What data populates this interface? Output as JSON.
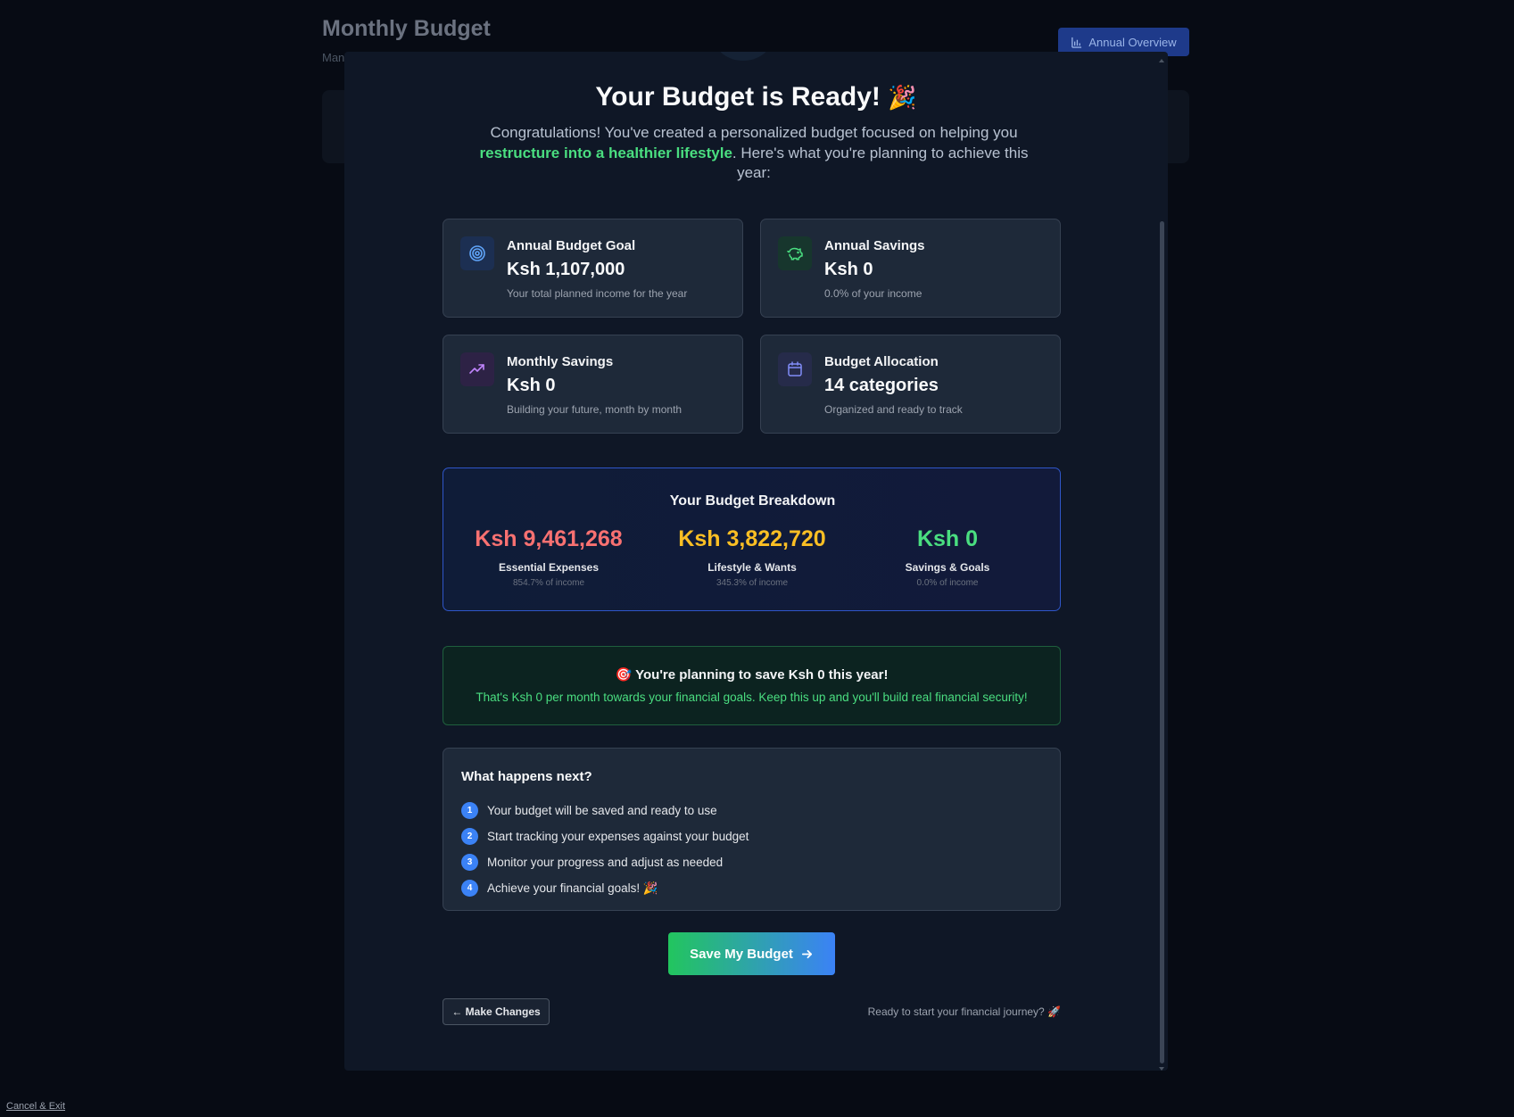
{
  "background": {
    "page_title": "Monthly Budget",
    "page_subtitle": "Man",
    "annual_overview_button": "Annual Overview",
    "cancel_exit_link": "Cancel & Exit"
  },
  "modal": {
    "heading": "Your Budget is Ready!",
    "heading_emoji": "🎉",
    "intro_before": "Congratulations! You've created a personalized budget focused on helping you ",
    "intro_highlight": "restructure into a healthier lifestyle",
    "intro_after": ". Here's what you're planning to achieve this year:",
    "stats": [
      {
        "label": "Annual Budget Goal",
        "value": "Ksh 1,107,000",
        "desc": "Your total planned income for the year",
        "icon": "target-icon",
        "color": "#60a5fa"
      },
      {
        "label": "Annual Savings",
        "value": "Ksh 0",
        "desc": "0.0% of your income",
        "icon": "piggy-bank-icon",
        "color": "#4ade80"
      },
      {
        "label": "Monthly Savings",
        "value": "Ksh 0",
        "desc": "Building your future, month by month",
        "icon": "trending-up-icon",
        "color": "#c084fc"
      },
      {
        "label": "Budget Allocation",
        "value": "14 categories",
        "desc": "Organized and ready to track",
        "icon": "calendar-icon",
        "color": "#818cf8"
      }
    ],
    "breakdown": {
      "title": "Your Budget Breakdown",
      "items": [
        {
          "value": "Ksh 9,461,268",
          "label": "Essential Expenses",
          "pct": "854.7% of income",
          "color": "#f87171"
        },
        {
          "value": "Ksh 3,822,720",
          "label": "Lifestyle & Wants",
          "pct": "345.3% of income",
          "color": "#fbbf24"
        },
        {
          "value": "Ksh 0",
          "label": "Savings & Goals",
          "pct": "0.0% of income",
          "color": "#4ade80"
        }
      ]
    },
    "savings_banner": {
      "emoji": "🎯",
      "title": "You're planning to save Ksh 0 this year!",
      "text": "That's Ksh 0 per month towards your financial goals. Keep this up and you'll build real financial security!"
    },
    "next_steps": {
      "title": "What happens next?",
      "items": [
        {
          "num": "1",
          "text": "Your budget will be saved and ready to use"
        },
        {
          "num": "2",
          "text": "Start tracking your expenses against your budget"
        },
        {
          "num": "3",
          "text": "Monitor your progress and adjust as needed"
        },
        {
          "num": "4",
          "text": "Achieve your financial goals! 🎉"
        }
      ]
    },
    "save_button": "Save My Budget",
    "make_changes_button": "← Make Changes",
    "ready_text": "Ready to start your financial journey? 🚀"
  }
}
